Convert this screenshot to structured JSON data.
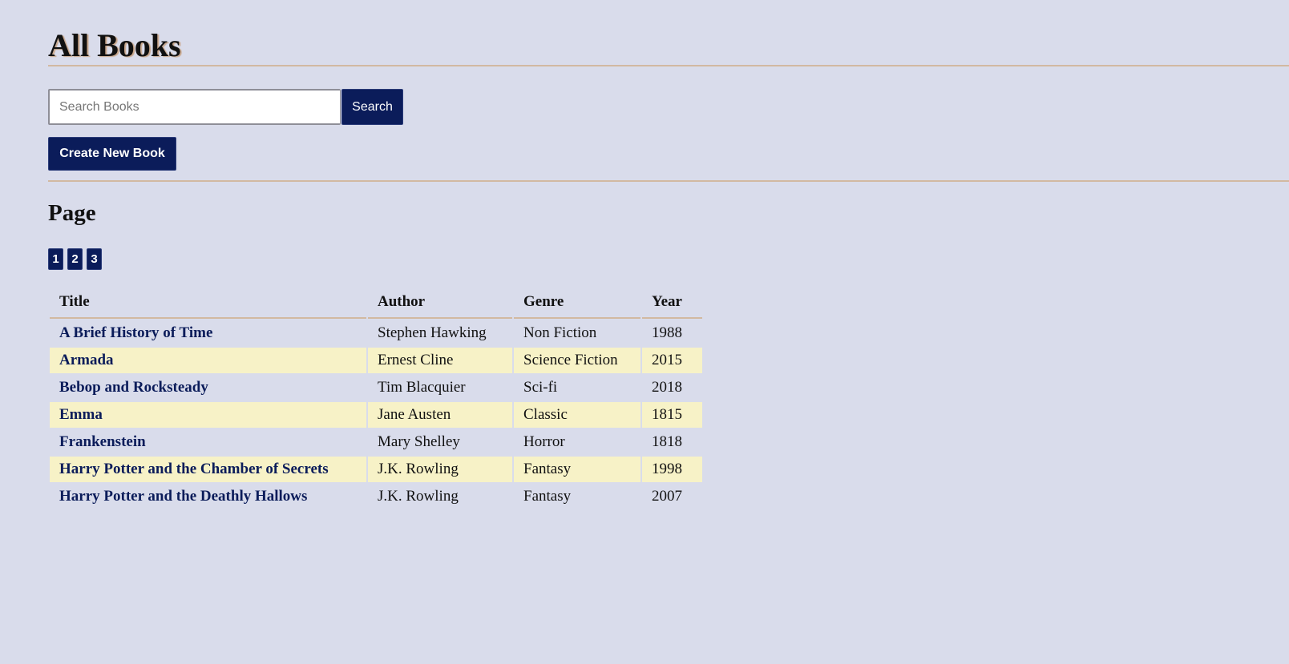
{
  "header": {
    "title": "All Books"
  },
  "search": {
    "placeholder": "Search Books",
    "value": "",
    "button_label": "Search"
  },
  "actions": {
    "create_label": "Create New Book"
  },
  "pagination": {
    "heading": "Page",
    "pages": [
      "1",
      "2",
      "3"
    ]
  },
  "table": {
    "columns": [
      "Title",
      "Author",
      "Genre",
      "Year"
    ],
    "rows": [
      {
        "title": "A Brief History of Time",
        "author": "Stephen Hawking",
        "genre": "Non Fiction",
        "year": "1988"
      },
      {
        "title": "Armada",
        "author": "Ernest Cline",
        "genre": "Science Fiction",
        "year": "2015"
      },
      {
        "title": "Bebop and Rocksteady",
        "author": "Tim Blacquier",
        "genre": "Sci-fi",
        "year": "2018"
      },
      {
        "title": "Emma",
        "author": "Jane Austen",
        "genre": "Classic",
        "year": "1815"
      },
      {
        "title": "Frankenstein",
        "author": "Mary Shelley",
        "genre": "Horror",
        "year": "1818"
      },
      {
        "title": "Harry Potter and the Chamber of Secrets",
        "author": "J.K. Rowling",
        "genre": "Fantasy",
        "year": "1998"
      },
      {
        "title": "Harry Potter and the Deathly Hallows",
        "author": "J.K. Rowling",
        "genre": "Fantasy",
        "year": "2007"
      }
    ]
  },
  "colors": {
    "background": "#d9dceb",
    "button": "#0b1c5a",
    "link": "#0b1c5a",
    "row_highlight": "#f7f2c7",
    "rule": "#d2b9a1"
  }
}
